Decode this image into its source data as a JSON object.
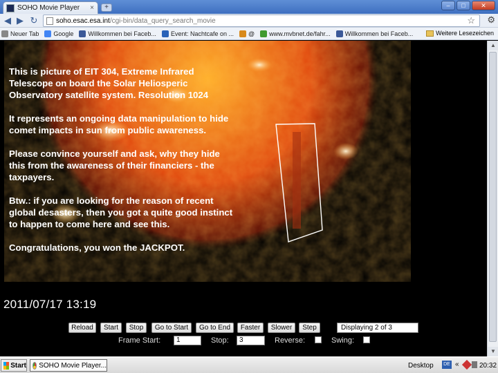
{
  "browser": {
    "tab_title": "SOHO Movie Player",
    "tab_close": "×",
    "new_tab": "+",
    "url_host": "soho.esac.esa.int",
    "url_path": "/cgi-bin/data_query_search_movie",
    "bookmarks": [
      {
        "label": "Neuer Tab",
        "color": "#888888"
      },
      {
        "label": "Google",
        "color": "#4285f4"
      },
      {
        "label": "Willkommen bei Faceb...",
        "color": "#3b5998"
      },
      {
        "label": "Event: Nachtcafe on ...",
        "color": "#2a63b8"
      },
      {
        "label": "@",
        "color": "#d88a1c"
      },
      {
        "label": "www.mvbnet.de/fahr...",
        "color": "#3f9a2f"
      },
      {
        "label": "Willkommen bei Faceb...",
        "color": "#3b5998"
      }
    ],
    "bookmarks_more": "»",
    "other_bookmarks": "Weitere Lesezeichen"
  },
  "page": {
    "paragraphs": [
      "This is picture of EIT 304, Extreme Infrared Telescope on board the Solar Heliosperic Observatory satellite system. Resolution 1024",
      "It represents an ongoing data manipulation to hide comet impacts in sun from public awareness.",
      "Please convince yourself and ask, why they hide this from the awareness of their financiers - the taxpayers.",
      "Btw.: if you are looking for the reason of recent global desasters, then you got a quite good instinct to happen to come here and see this.",
      "Congratulations, you won the JACKPOT."
    ],
    "timestamp": "2011/07/17 13:19"
  },
  "controls": {
    "buttons": {
      "reload": "Reload",
      "start": "Start",
      "stop": "Stop",
      "go_to_start": "Go to Start",
      "go_to_end": "Go to End",
      "faster": "Faster",
      "slower": "Slower",
      "step": "Step"
    },
    "status": "Displaying 2 of 3",
    "frame_start_label": "Frame Start:",
    "frame_start_value": "1",
    "stop_label": "Stop:",
    "stop_value": "3",
    "reverse_label": "Reverse:",
    "swing_label": "Swing:"
  },
  "taskbar": {
    "start_label": "Start",
    "task_label": "SOHO Movie Player...",
    "desktop_label": "Desktop",
    "lang": "DE",
    "chevron": "«",
    "clock": "20:32"
  },
  "colors": {
    "sun_core": "#ffb02a",
    "sun_mid": "#e0470d",
    "sun_edge": "#5a0e04",
    "text": "#ffffff"
  }
}
